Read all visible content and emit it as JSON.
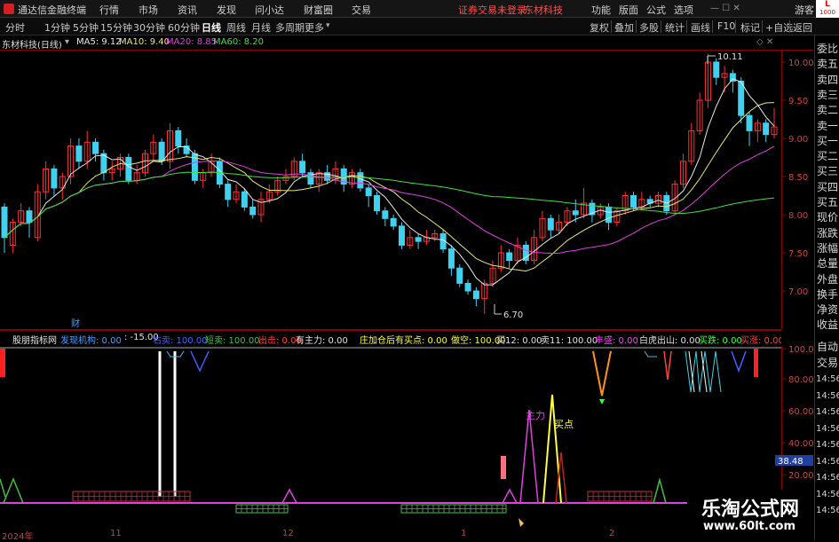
{
  "titlebar": {
    "app": "通达信金融终端",
    "menus": [
      "行情",
      "市场",
      "资讯",
      "发现",
      "问小达",
      "财富圈",
      "交易"
    ],
    "login_notice": "证券交易未登录",
    "stock": "东材科技",
    "right": [
      "功能",
      "版面",
      "公式",
      "选项"
    ],
    "guest": "游客",
    "badge_l": "L",
    "badge_num": "1000"
  },
  "toolbar": {
    "periods": [
      "分时",
      "1分钟",
      "5分钟",
      "15分钟",
      "30分钟",
      "60分钟",
      "日线",
      "周线",
      "月线",
      "多周期",
      "更多"
    ],
    "active_period": "日线",
    "right": [
      "复权",
      "叠加",
      "多股",
      "统计",
      "画线",
      "F10",
      "标记",
      "+自选",
      "返回"
    ]
  },
  "legend": {
    "title": "东材科技(日线)",
    "ma": [
      {
        "label": "MA5: 9.12",
        "color": "#e8e8e8"
      },
      {
        "label": "MA10: 9.40",
        "color": "#e8e870"
      },
      {
        "label": "MA20: 8.85",
        "color": "#e040e0"
      },
      {
        "label": "MA60: 8.20",
        "color": "#40e040"
      }
    ]
  },
  "price_axis": [
    "10.00",
    "9.50",
    "9.00",
    "8.50",
    "8.00",
    "7.50",
    "7.00"
  ],
  "annotations": {
    "high": "10.11",
    "low": "6.70",
    "cai": "财"
  },
  "indicator": {
    "name": "股朋指标网",
    "items": [
      {
        "t": "发现机构: 0.00",
        "c": "#40a0ff"
      },
      {
        "t": ": -15.00",
        "c": "#e0e0e0"
      },
      {
        "t": "右卖: 100.00",
        "c": "#4060ff"
      },
      {
        "t": "短卖: 100.00",
        "c": "#40c040"
      },
      {
        "t": "出击: 0.00",
        "c": "#ff4040"
      },
      {
        "t": "有主力: 0.00",
        "c": "#e0e0e0"
      },
      {
        "t": "庄加仓后有买点: 0.00",
        "c": "#ffff40"
      },
      {
        "t": "做空: 100.00",
        "c": "#ffff40"
      },
      {
        "t": "买12: 0.00",
        "c": "#e0e0e0"
      },
      {
        "t": "卖11: 100.00",
        "c": "#e0e0e0"
      },
      {
        "t": "丰盛: 0.00",
        "c": "#ff40ff"
      },
      {
        "t": "白虎出山: 0.00",
        "c": "#e0e0e0"
      },
      {
        "t": "买跌: 0.00",
        "c": "#40ff40"
      },
      {
        "t": "买涨: 0.00",
        "c": "#ff4040"
      }
    ],
    "axis": [
      "100.0",
      "80.00",
      "60.00",
      "40.00",
      "20.00"
    ],
    "current": "38.48",
    "labels": {
      "zhuli": "主力",
      "maidian": "买点"
    }
  },
  "time_axis": [
    "2024年",
    "11",
    "12",
    "1",
    "2"
  ],
  "right_panel": {
    "items": [
      "委比",
      "卖五",
      "卖四",
      "卖三",
      "卖二",
      "卖一",
      "买一",
      "买二",
      "买三",
      "买四",
      "买五",
      "现价",
      "涨跌",
      "涨幅",
      "总量",
      "外盘",
      "换手",
      "净资",
      "收益"
    ],
    "times": [
      "自动",
      "交易",
      "14:56",
      "14:56",
      "14:56",
      "14:56",
      "14:56",
      "14:56",
      "14:56",
      "14:56",
      "14:56"
    ]
  },
  "watermark": {
    "brand": "乐淘公式网",
    "url": "www.60lt.com"
  },
  "chart_data": {
    "type": "candlestick",
    "ylim": [
      6.7,
      10.11
    ],
    "ma_current": {
      "MA5": 9.12,
      "MA10": 9.4,
      "MA20": 8.85,
      "MA60": 8.2
    },
    "low_point": 6.7,
    "high_point": 10.11,
    "colors": {
      "up": "#ff3030",
      "down": "#40d0f0"
    }
  }
}
